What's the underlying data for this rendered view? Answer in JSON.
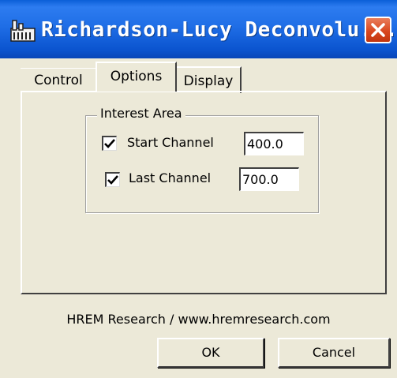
{
  "window": {
    "title": "Richardson-Lucy Deconvolu...",
    "icon": "app-icon",
    "close_icon": "close-icon"
  },
  "tabs": [
    {
      "label": "Control",
      "selected": false
    },
    {
      "label": "Options",
      "selected": true
    },
    {
      "label": "Display",
      "selected": false
    }
  ],
  "interest_area": {
    "label": "Interest Area",
    "start_channel": {
      "label": "Start Channel",
      "checked": true,
      "value": "400.0"
    },
    "last_channel": {
      "label": "Last Channel",
      "checked": true,
      "value": "700.0"
    }
  },
  "footer": {
    "credit": "HREM Research / www.hremresearch.com",
    "ok_label": "OK",
    "cancel_label": "Cancel"
  },
  "colors": {
    "titlebar": "#1f6ee6",
    "close_button": "#d9481f",
    "dialog_background": "#ece9d8"
  }
}
